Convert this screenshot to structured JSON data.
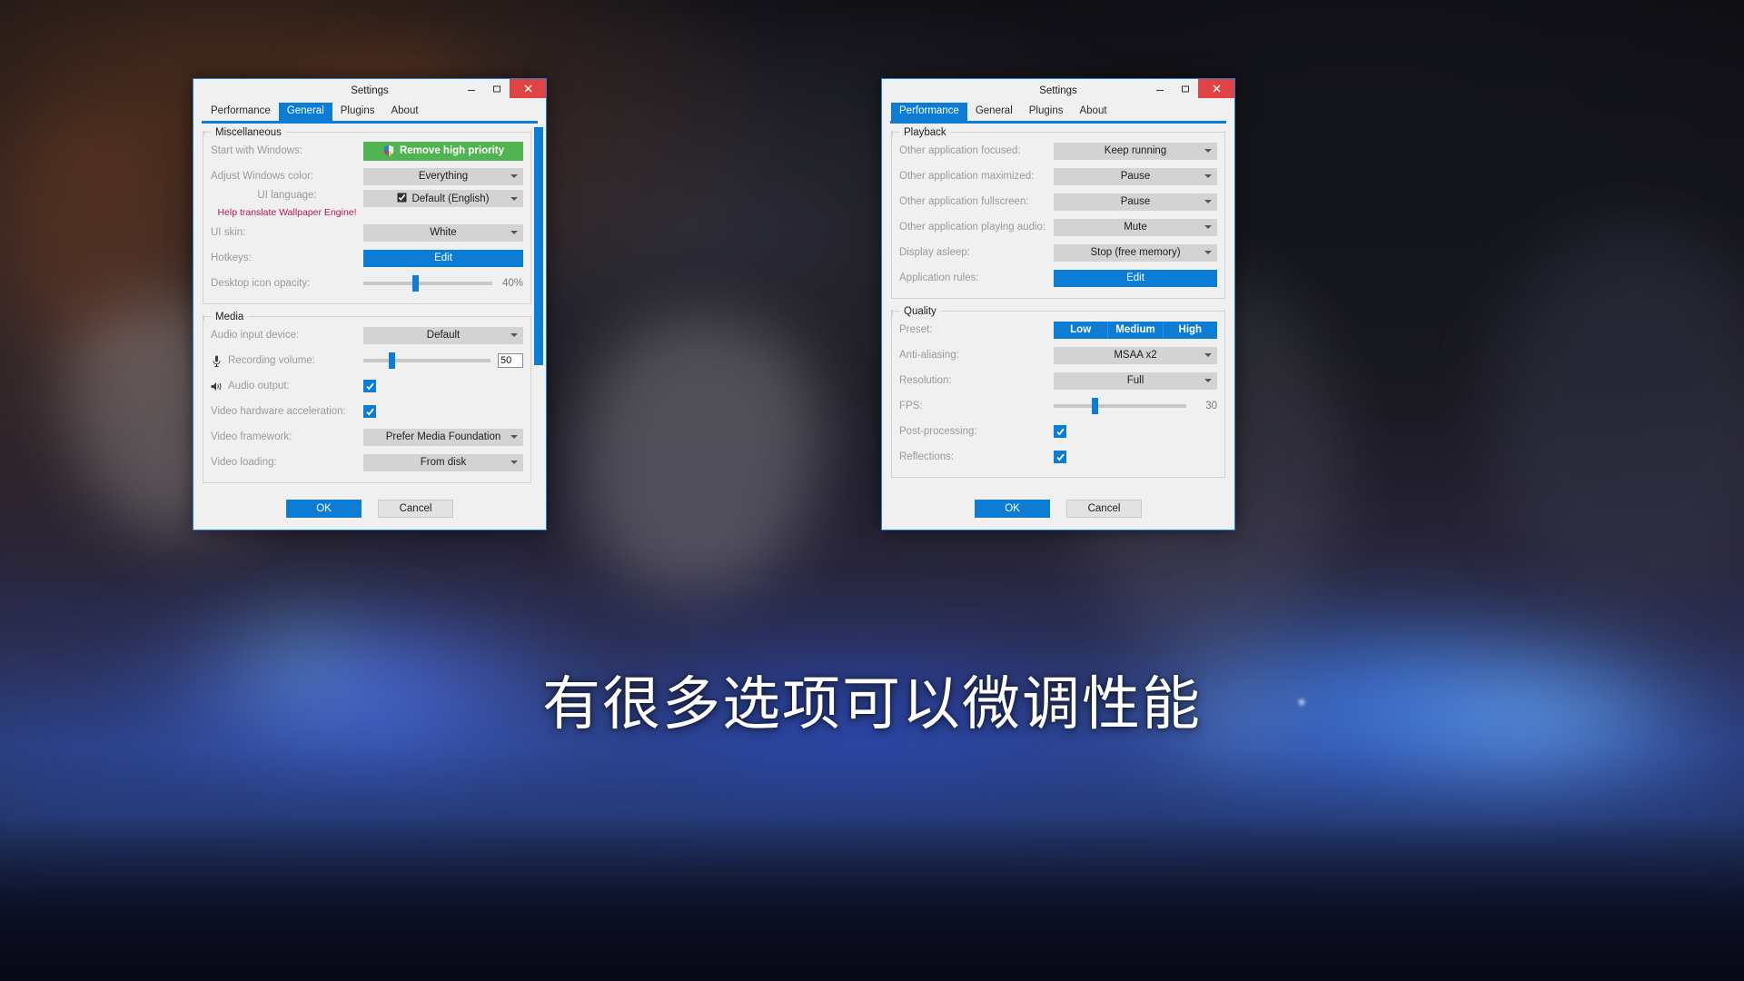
{
  "subtitle": "有很多选项可以微调性能",
  "left_window": {
    "title": "Settings",
    "caption": {
      "minimize": "–",
      "maximize": "▢",
      "close": "✕"
    },
    "tabs": [
      {
        "label": "Performance",
        "active": false
      },
      {
        "label": "General",
        "active": true
      },
      {
        "label": "Plugins",
        "active": false
      },
      {
        "label": "About",
        "active": false
      }
    ],
    "groups": [
      {
        "legend": "Miscellaneous",
        "rows": [
          {
            "label": "Start with Windows:",
            "type": "green-button",
            "value": "Remove high priority",
            "icon": "shield-icon"
          },
          {
            "label": "Adjust Windows color:",
            "type": "combo",
            "value": "Everything"
          },
          {
            "label": "UI language:",
            "sublabel": "Help translate Wallpaper Engine!",
            "type": "combo",
            "value": "Default (English)",
            "lead_icon": "checkbox-glyph"
          },
          {
            "label": "UI skin:",
            "type": "combo",
            "value": "White"
          },
          {
            "label": "Hotkeys:",
            "type": "blue-button",
            "value": "Edit"
          },
          {
            "label": "Desktop icon opacity:",
            "type": "slider",
            "value": "40%",
            "percent": 40
          }
        ]
      },
      {
        "legend": "Media",
        "rows": [
          {
            "label": "Audio input device:",
            "type": "combo",
            "value": "Default"
          },
          {
            "label": "Recording volume:",
            "type": "slider-input",
            "value": "50",
            "percent": 22,
            "icon": "microphone-icon"
          },
          {
            "label": "Audio output:",
            "type": "checkbox",
            "checked": true,
            "icon": "speaker-icon"
          },
          {
            "label": "Video hardware acceleration:",
            "type": "checkbox",
            "checked": true
          },
          {
            "label": "Video framework:",
            "type": "combo",
            "value": "Prefer Media Foundation"
          },
          {
            "label": "Video loading:",
            "type": "combo",
            "value": "From disk"
          }
        ]
      }
    ],
    "footer": {
      "ok": "OK",
      "cancel": "Cancel"
    }
  },
  "right_window": {
    "title": "Settings",
    "caption": {
      "minimize": "–",
      "maximize": "▢",
      "close": "✕"
    },
    "tabs": [
      {
        "label": "Performance",
        "active": true
      },
      {
        "label": "General",
        "active": false
      },
      {
        "label": "Plugins",
        "active": false
      },
      {
        "label": "About",
        "active": false
      }
    ],
    "groups": [
      {
        "legend": "Playback",
        "rows": [
          {
            "label": "Other application focused:",
            "type": "combo",
            "value": "Keep running"
          },
          {
            "label": "Other application maximized:",
            "type": "combo",
            "value": "Pause"
          },
          {
            "label": "Other application fullscreen:",
            "type": "combo",
            "value": "Pause"
          },
          {
            "label": "Other application playing audio:",
            "type": "combo",
            "value": "Mute"
          },
          {
            "label": "Display asleep:",
            "type": "combo",
            "value": "Stop (free memory)"
          },
          {
            "label": "Application rules:",
            "type": "blue-button",
            "value": "Edit"
          }
        ]
      },
      {
        "legend": "Quality",
        "rows": [
          {
            "label": "Preset:",
            "type": "segmented",
            "options": [
              "Low",
              "Medium",
              "High"
            ]
          },
          {
            "label": "Anti-aliasing:",
            "type": "combo",
            "value": "MSAA x2"
          },
          {
            "label": "Resolution:",
            "type": "combo",
            "value": "Full"
          },
          {
            "label": "FPS:",
            "type": "slider",
            "value": "30",
            "percent": 31
          },
          {
            "label": "Post-processing:",
            "type": "checkbox",
            "checked": true
          },
          {
            "label": "Reflections:",
            "type": "checkbox",
            "checked": true
          }
        ]
      }
    ],
    "footer": {
      "ok": "OK",
      "cancel": "Cancel"
    }
  },
  "colors": {
    "accent_blue": "#0c7cd5",
    "close_red": "#e04343",
    "green_button": "#52b352",
    "help_link_magenta": "#b9184a"
  }
}
